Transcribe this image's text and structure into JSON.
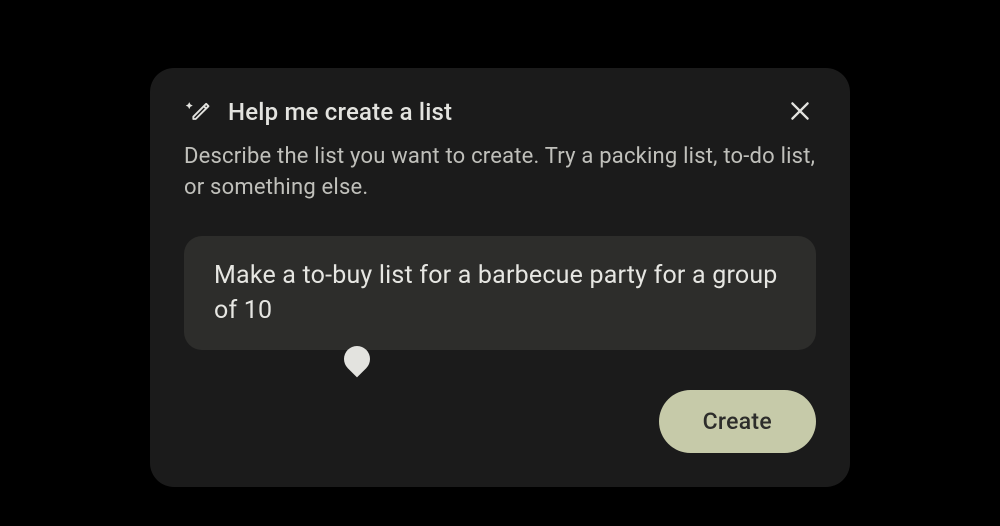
{
  "dialog": {
    "title": "Help me create a list",
    "subtitle": "Describe the list you want to create. Try a packing list, to-do list, or something else.",
    "input_value": "Make a to-buy list for a barbecue party for a group of 10",
    "create_label": "Create"
  }
}
